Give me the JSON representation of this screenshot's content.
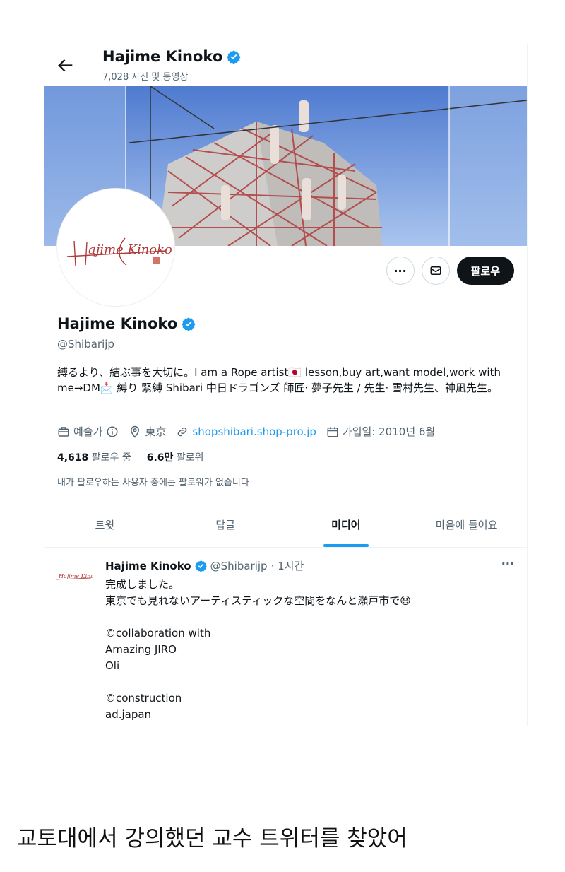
{
  "header": {
    "name": "Hajime Kinoko",
    "post_count": "7,028 사진 및 동영상"
  },
  "profile": {
    "avatar_signature": "Hajime Kinoko",
    "name": "Hajime Kinoko",
    "handle": "@Shibarijp",
    "bio": "縛るより、結ぶ事を大切に。I am a Rope artist🇯🇵 lesson,buy art,want model,work with me→DM📩 縛り 緊縛 Shibari 中日ドラゴンズ 師匠· 夢子先生 / 先生· 雪村先生、神凪先生。",
    "category": "예술가",
    "location": "東京",
    "website": "shopshibari.shop-pro.jp",
    "joined": "가입일: 2010년 6월",
    "following_count": "4,618",
    "following_label": "팔로우 중",
    "followers_count": "6.6만",
    "followers_label": "팔로워",
    "mutual_note": "내가 팔로우하는 사용자 중에는 팔로워가 없습니다"
  },
  "actions": {
    "more": "···",
    "follow": "팔로우"
  },
  "tabs": [
    {
      "label": "트윗"
    },
    {
      "label": "답글"
    },
    {
      "label": "미디어"
    },
    {
      "label": "마음에 들어요"
    }
  ],
  "tweet": {
    "name": "Hajime Kinoko",
    "handle": "@Shibarijp",
    "time": "· 1시간",
    "more": "···",
    "body": "完成しました。\n東京でも見れないアーティスティックな空間をなんと瀬戸市で😆\n\n©collaboration with\nAmazing JIRO\nOli\n\n©construction\nad.japan"
  },
  "caption": "교토대에서 강의했던 교수 트위터를 찾았어",
  "colors": {
    "accent": "#1d9bf0",
    "text": "#0f1419",
    "muted": "#536471",
    "follow_button": "#0f1419",
    "rope": "#b03a3a"
  }
}
